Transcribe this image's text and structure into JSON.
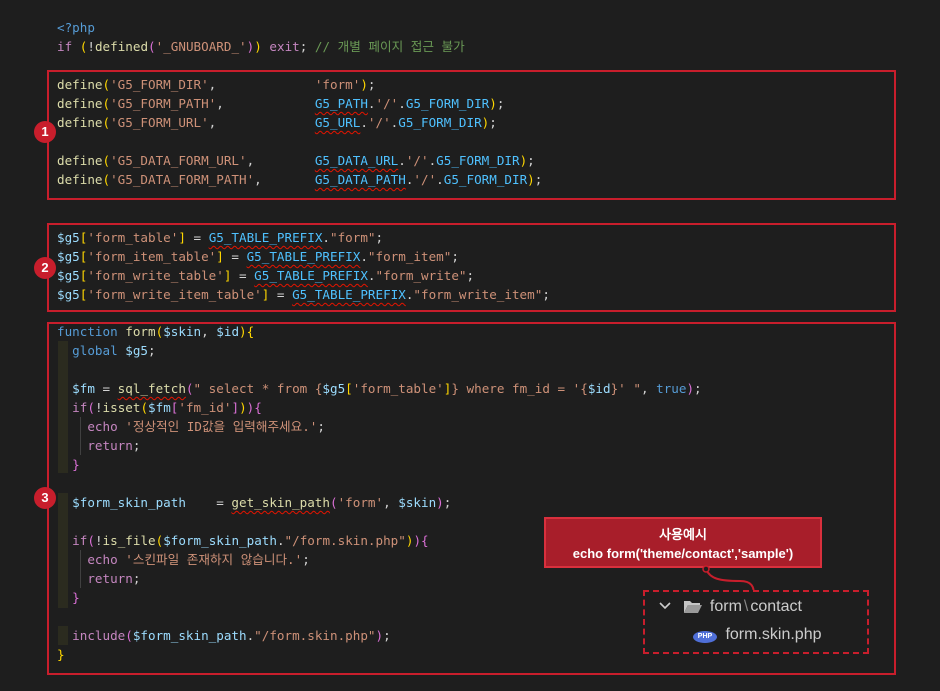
{
  "code": {
    "php_open": "<?php",
    "guard_if": "if",
    "guard_fn": "defined",
    "guard_const": "'_GNUBOARD_'",
    "guard_exit": "exit",
    "guard_comment": "// 개별 페이지 접근 불가",
    "define": "define",
    "defines": [
      {
        "name": "'G5_FORM_DIR'",
        "value": "'form'"
      },
      {
        "name": "'G5_FORM_PATH'",
        "const": "G5_PATH",
        "mid": "'/'",
        "tail": "G5_FORM_DIR"
      },
      {
        "name": "'G5_FORM_URL'",
        "const": "G5_URL",
        "mid": "'/'",
        "tail": "G5_FORM_DIR"
      },
      {
        "name": "'G5_DATA_FORM_URL'",
        "const": "G5_DATA_URL",
        "mid": "'/'",
        "tail": "G5_FORM_DIR"
      },
      {
        "name": "'G5_DATA_FORM_PATH'",
        "const": "G5_DATA_PATH",
        "mid": "'/'",
        "tail": "G5_FORM_DIR"
      }
    ],
    "g5_var": "$g5",
    "prefix": "G5_TABLE_PREFIX",
    "tables": [
      {
        "key": "'form_table'",
        "suffix": "\"form\""
      },
      {
        "key": "'form_item_table'",
        "suffix": "\"form_item\""
      },
      {
        "key": "'form_write_table'",
        "suffix": "\"form_write\""
      },
      {
        "key": "'form_write_item_table'",
        "suffix": "\"form_write_item\""
      }
    ],
    "fn_kw": "function",
    "fn_name": "form",
    "arg_skin": "$skin",
    "arg_id": "$id",
    "global_kw": "global",
    "fm_var": "$fm",
    "sql_fn": "sql_fetch",
    "sql_a": "\" select * from {",
    "sql_key": "'form_table'",
    "sql_b": "} where fm_id = '{",
    "sql_c": "}' \"",
    "true_kw": "true",
    "isset_fn": "isset",
    "fm_id_key": "'fm_id'",
    "echo_kw": "echo",
    "msg_id": "'정상적인 ID값을 입력해주세요.'",
    "return_kw": "return",
    "skin_path_var": "$form_skin_path",
    "get_skin_fn": "get_skin_path",
    "skin_arg": "'form'",
    "is_file_fn": "is_file",
    "skin_file": "\"/form.skin.php\"",
    "msg_skin": "'스킨파일 존재하지 않습니다.'",
    "include_kw": "include"
  },
  "badges": [
    "1",
    "2",
    "3"
  ],
  "callout": {
    "line1": "사용예시",
    "line2": "echo form('theme/contact','sample')"
  },
  "tree": {
    "folder_a": "form",
    "sep": "\\",
    "folder_b": "contact",
    "file": "form.skin.php",
    "file_icon_text": "PHP"
  },
  "colors": {
    "accent_red": "#c81e2c",
    "editor_bg": "#1e1e1e"
  }
}
